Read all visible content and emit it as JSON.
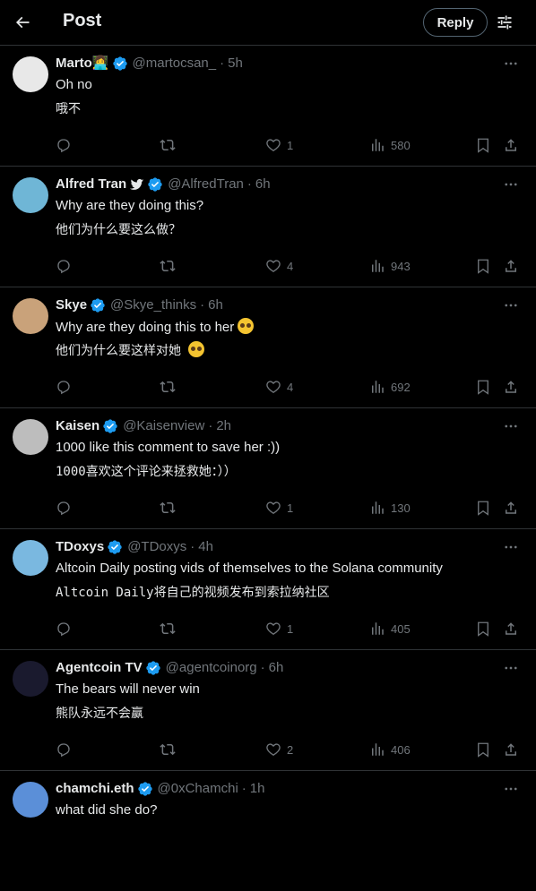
{
  "header": {
    "title": "Post",
    "reply_label": "Reply"
  },
  "colors": {
    "background": "#000000",
    "text": "#e7e9ea",
    "muted": "#71767b",
    "verified": "#1d9bf0",
    "border": "#2f3336"
  },
  "posts": [
    {
      "name": "Marto👩‍💻",
      "handle": "@martocsan_",
      "time": "5h",
      "text": "Oh no",
      "translation": "哦不",
      "likes": "1",
      "views": "580",
      "avatar_color": "#e8e8e8",
      "bird": false,
      "emoji": false
    },
    {
      "name": "Alfred Tran",
      "handle": "@AlfredTran",
      "time": "6h",
      "text": "Why are they doing this?",
      "translation": "他们为什么要这么做？",
      "likes": "4",
      "views": "943",
      "avatar_color": "#6fb6d6",
      "bird": true,
      "emoji": false
    },
    {
      "name": "Skye",
      "handle": "@Skye_thinks",
      "time": "6h",
      "text": "Why are they doing this to her",
      "translation": "他们为什么要这样对她",
      "likes": "4",
      "views": "692",
      "avatar_color": "#c9a27a",
      "bird": false,
      "emoji": true
    },
    {
      "name": "Kaisen",
      "handle": "@Kaisenview",
      "time": "2h",
      "text": "1000 like this comment to save her :))",
      "translation": "1000喜欢这个评论来拯救她：））",
      "likes": "1",
      "views": "130",
      "avatar_color": "#bdbdbd",
      "bird": false,
      "emoji": false
    },
    {
      "name": "TDoxys",
      "handle": "@TDoxys",
      "time": "4h",
      "text": "Altcoin Daily posting vids of themselves to the Solana community",
      "translation": "Altcoin Daily将自己的视频发布到索拉纳社区",
      "likes": "1",
      "views": "405",
      "avatar_color": "#7ab8e0",
      "bird": false,
      "emoji": false
    },
    {
      "name": "Agentcoin TV",
      "handle": "@agentcoinorg",
      "time": "6h",
      "text": "The bears will never win",
      "translation": "熊队永远不会赢",
      "likes": "2",
      "views": "406",
      "avatar_color": "#1a1a2e",
      "bird": false,
      "emoji": false
    },
    {
      "name": "chamchi.eth",
      "handle": "@0xChamchi",
      "time": "1h",
      "text": "what did she do?",
      "translation": "",
      "likes": "",
      "views": "",
      "avatar_color": "#5b8fd8",
      "bird": false,
      "emoji": false
    }
  ]
}
